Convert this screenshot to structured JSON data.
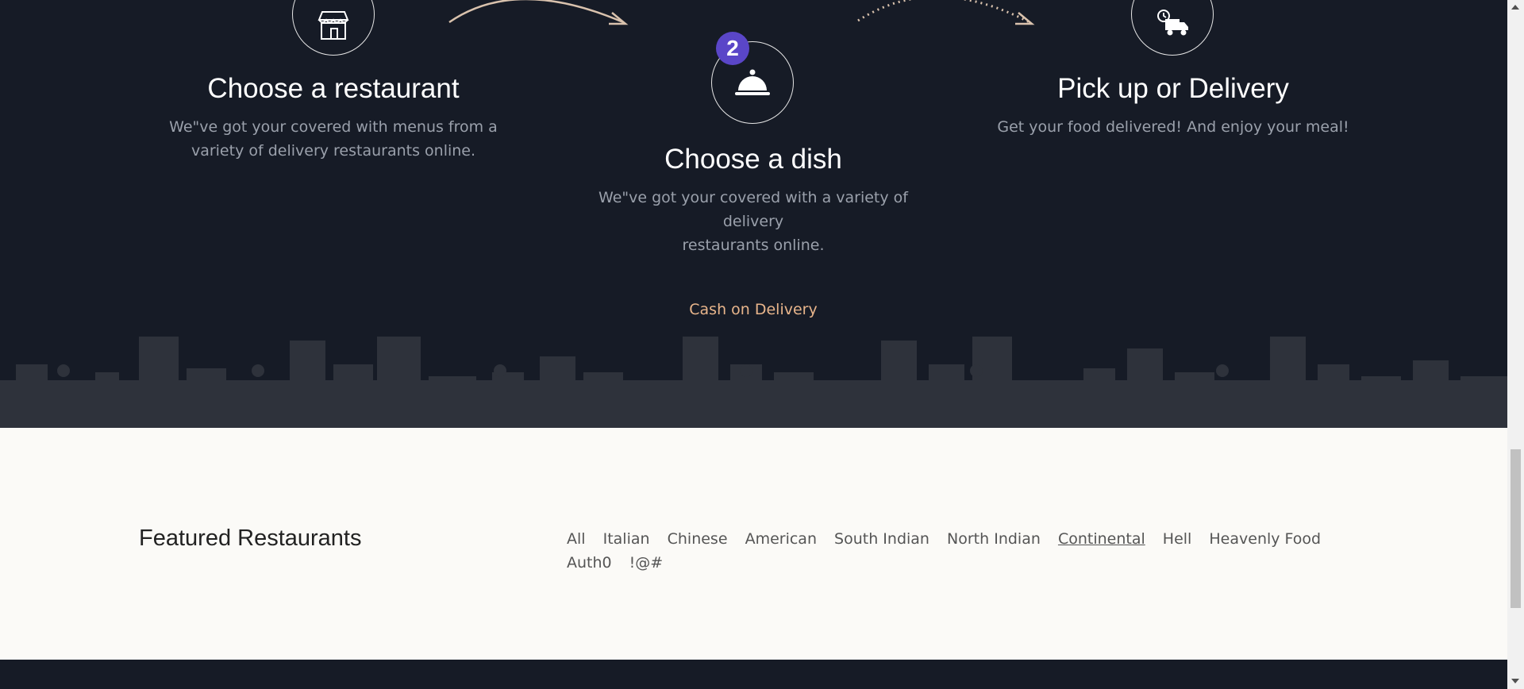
{
  "steps": [
    {
      "title": "Choose a restaurant",
      "desc_line1": "We\"ve got your covered with menus from a",
      "desc_line2": "variety of delivery restaurants online."
    },
    {
      "badge": "2",
      "title": "Choose a dish",
      "desc_line1": "We\"ve got your covered with a variety of delivery",
      "desc_line2": "restaurants online."
    },
    {
      "title": "Pick up or Delivery",
      "desc_line1": "Get your food delivered! And enjoy your meal!"
    }
  ],
  "cod_link": "Cash on Delivery",
  "featured": {
    "title": "Featured Restaurants",
    "filters": [
      "All",
      "Italian",
      "Chinese",
      "American",
      "South Indian",
      "North Indian",
      "Continental",
      "Hell",
      "Heavenly Food",
      "Auth0",
      "!@#"
    ],
    "active_filter": "Continental"
  },
  "colors": {
    "dark_bg": "#161b26",
    "accent": "#e8b58b",
    "badge": "#5a46c8",
    "light_bg": "#fbfaf7"
  },
  "icons": [
    "store-icon",
    "food-cloche-icon",
    "delivery-truck-icon",
    "arrow-icon"
  ]
}
